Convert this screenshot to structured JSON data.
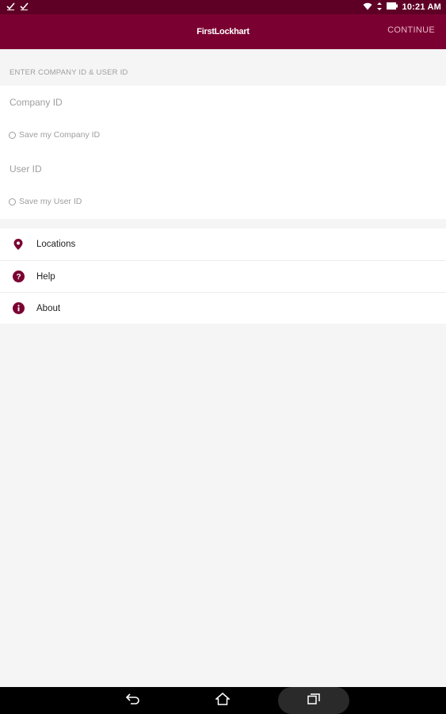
{
  "status_bar": {
    "left_icons": [
      "download-check-icon",
      "download-check-icon"
    ],
    "right_icons": [
      "wifi-icon",
      "data-arrows-icon",
      "battery-icon"
    ],
    "time": "10:21 AM"
  },
  "app_bar": {
    "brand": "FirstLockhart",
    "continue_label": "CONTINUE",
    "color": "#7b0032"
  },
  "form": {
    "section_header": "ENTER COMPANY ID & USER ID",
    "company_id_placeholder": "Company ID",
    "save_company_label": "Save my Company ID",
    "user_id_placeholder": "User ID",
    "save_user_label": "Save my User ID"
  },
  "menu": {
    "items": [
      {
        "label": "Locations",
        "icon": "location-pin-icon"
      },
      {
        "label": "Help",
        "icon": "help-icon"
      },
      {
        "label": "About",
        "icon": "info-icon"
      }
    ],
    "icon_color": "#7b0032"
  },
  "nav_bar": {
    "buttons": [
      "back-icon",
      "home-icon",
      "recents-icon"
    ]
  }
}
